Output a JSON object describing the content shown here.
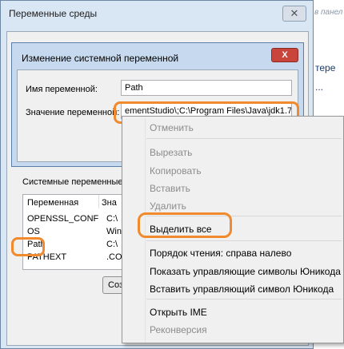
{
  "outer_dialog": {
    "title": "Переменные среды"
  },
  "background_page": {
    "hint": "в панел",
    "text1": "тере",
    "text2": "..."
  },
  "edit_dialog": {
    "title": "Изменение системной переменной",
    "close_label": "X",
    "name_label": "Имя переменной:",
    "name_value": "Path",
    "value_label": "Значение переменной:",
    "value_value": "ementStudio\\;C:\\Program Files\\Java\\jdk1.7"
  },
  "system_vars": {
    "label": "Системные переменные",
    "columns": [
      "Переменная",
      "Зна"
    ],
    "rows": [
      {
        "name": "OPENSSL_CONF",
        "value": "C:\\"
      },
      {
        "name": "OS",
        "value": "Win"
      },
      {
        "name": "Path",
        "value": "C:\\"
      },
      {
        "name": "PATHEXT",
        "value": ".CO"
      }
    ],
    "create_button": "Соз"
  },
  "context_menu": {
    "items": [
      {
        "label": "Отменить",
        "enabled": false
      },
      {
        "label": "Вырезать",
        "enabled": false
      },
      {
        "label": "Копировать",
        "enabled": false
      },
      {
        "label": "Вставить",
        "enabled": false
      },
      {
        "label": "Удалить",
        "enabled": false
      },
      {
        "label": "Выделить все",
        "enabled": true
      },
      {
        "label": "Порядок чтения: справа налево",
        "enabled": true
      },
      {
        "label": "Показать управляющие символы Юникода",
        "enabled": true
      },
      {
        "label": "Вставить управляющий символ Юникода",
        "enabled": true
      },
      {
        "label": "Открыть IME",
        "enabled": true
      },
      {
        "label": "Реконверсия",
        "enabled": false
      }
    ]
  },
  "colors": {
    "highlight": "#f08a2c",
    "close_button": "#c9453c"
  }
}
